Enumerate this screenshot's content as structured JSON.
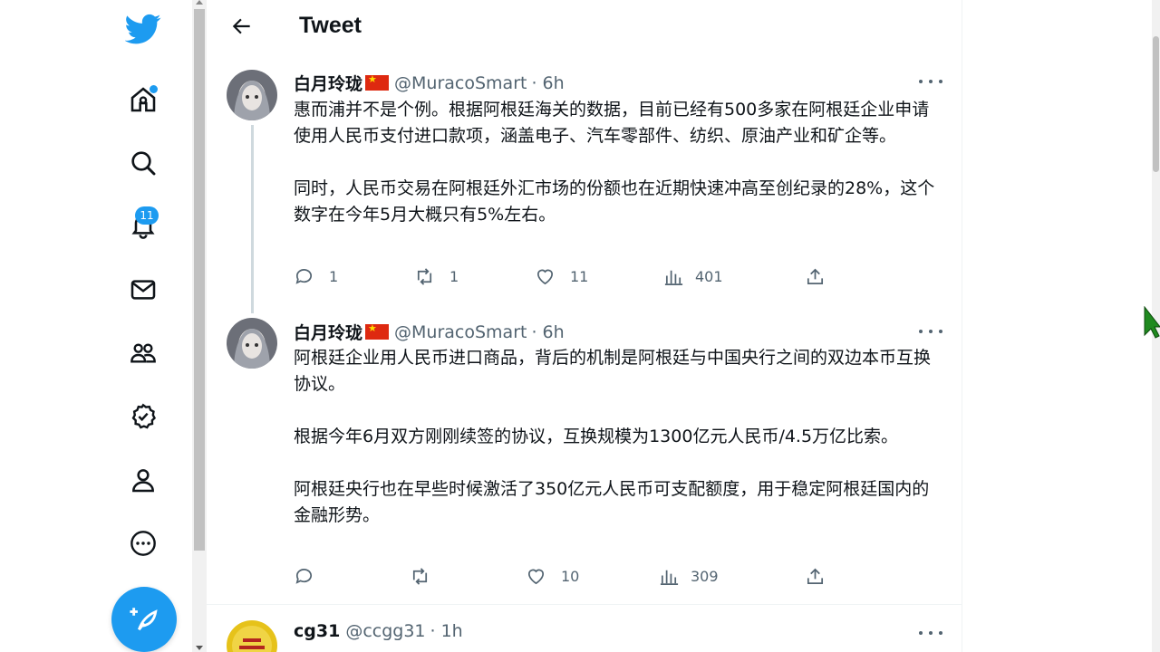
{
  "header": {
    "title": "Tweet"
  },
  "nav": {
    "items": [
      {
        "name": "home",
        "badge": ""
      },
      {
        "name": "explore",
        "badge": ""
      },
      {
        "name": "notifications",
        "badge": "11"
      },
      {
        "name": "messages",
        "badge": ""
      },
      {
        "name": "communities",
        "badge": ""
      },
      {
        "name": "verified",
        "badge": ""
      },
      {
        "name": "profile",
        "badge": ""
      },
      {
        "name": "more",
        "badge": ""
      }
    ],
    "accent": "#1d9bf0"
  },
  "tweets": [
    {
      "name": "白月玲珑",
      "handle": "@MuracoSmart",
      "time": "· 6h",
      "text": "惠而浦并不是个例。根据阿根廷海关的数据，目前已经有500多家在阿根廷企业申请使用人民币支付进口款项，涵盖电子、汽车零部件、纺织、原油产业和矿企等。\n\n同时，人民币交易在阿根廷外汇市场的份额也在近期快速冲高至创纪录的28%，这个数字在今年5月大概只有5%左右。",
      "replies": "1",
      "retweets": "1",
      "likes": "11",
      "views": "401"
    },
    {
      "name": "白月玲珑",
      "handle": "@MuracoSmart",
      "time": "· 6h",
      "text": "阿根廷企业用人民币进口商品，背后的机制是阿根廷与中国央行之间的双边本币互换协议。\n\n根据今年6月双方刚刚续签的协议，互换规模为1300亿元人民币/4.5万亿比索。\n\n阿根廷央行也在早些时候激活了350亿元人民币可支配额度，用于稳定阿根廷国内的金融形势。",
      "replies": "",
      "retweets": "",
      "likes": "10",
      "views": "309"
    },
    {
      "name": "cg31",
      "handle": "@ccgg31",
      "time": "· 1h"
    }
  ]
}
